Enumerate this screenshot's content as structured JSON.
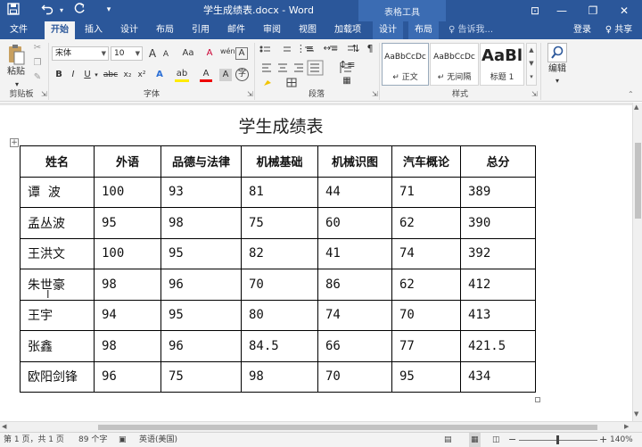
{
  "window": {
    "doc_title": "学生成绩表.docx - Word",
    "table_tools": "表格工具",
    "qat": {
      "save_icon": "save-icon",
      "undo_icon": "undo-icon",
      "redo_icon": "redo-icon",
      "customize": "▾"
    },
    "controls": {
      "ribbon_display": "⊡",
      "minimize": "—",
      "restore": "❐",
      "close": "✕"
    }
  },
  "tabs": [
    "文件",
    "开始",
    "插入",
    "设计",
    "布局",
    "引用",
    "邮件",
    "审阅",
    "视图",
    "加载项",
    "设计",
    "布局"
  ],
  "active_tab": "开始",
  "tell_me": "♀ 告诉我...",
  "account": {
    "login": "登录",
    "share": "♀ 共享"
  },
  "ribbon": {
    "clipboard": {
      "paste": "粘贴",
      "label": "剪贴板"
    },
    "font": {
      "font_name": "宋体",
      "font_size": "10",
      "grow": "A",
      "shrink": "A",
      "case": "Aa",
      "clear": "A",
      "phonetic": "wén",
      "border_char": "A",
      "bold": "B",
      "italic": "I",
      "underline": "U",
      "strike": "abc",
      "subscript": "x₂",
      "superscript": "x²",
      "effects": "A",
      "highlight": "ab",
      "font_color": "A",
      "shade": "A",
      "circle": "字",
      "label": "字体"
    },
    "paragraph": {
      "label": "段落"
    },
    "styles": {
      "items": [
        {
          "sample": "AaBbCcDc",
          "name": "↵ 正文"
        },
        {
          "sample": "AaBbCcDc",
          "name": "↵ 无间隔"
        },
        {
          "sample": "AaBl",
          "name": "标题 1"
        }
      ],
      "label": "样式"
    },
    "editing": {
      "label": "编辑"
    }
  },
  "document": {
    "heading": "学生成绩表",
    "columns": [
      "姓名",
      "外语",
      "品德与法律",
      "机械基础",
      "机械识图",
      "汽车概论",
      "总分"
    ],
    "rows": [
      [
        "谭  波",
        "100",
        "93",
        "81",
        "44",
        "71",
        "389"
      ],
      [
        "孟丛波",
        "95",
        "98",
        "75",
        "60",
        "62",
        "390"
      ],
      [
        "王洪文",
        "100",
        "95",
        "82",
        "41",
        "74",
        "392"
      ],
      [
        "朱世豪",
        "98",
        "96",
        "70",
        "86",
        "62",
        "412"
      ],
      [
        "王宇",
        "94",
        "95",
        "80",
        "74",
        "70",
        "413"
      ],
      [
        "张鑫",
        "98",
        "96",
        "84.5",
        "66",
        "77",
        "421.5"
      ],
      [
        "欧阳剑锋",
        "96",
        "75",
        "98",
        "70",
        "95",
        "434"
      ]
    ]
  },
  "status": {
    "page": "第 1 页，共 1 页",
    "words": "89 个字",
    "language": "英语(美国)",
    "zoom": "140%",
    "zoom_minus": "−",
    "zoom_plus": "+"
  },
  "colors": {
    "accent": "#2b579a",
    "ribbon": "#f3f3f3"
  }
}
